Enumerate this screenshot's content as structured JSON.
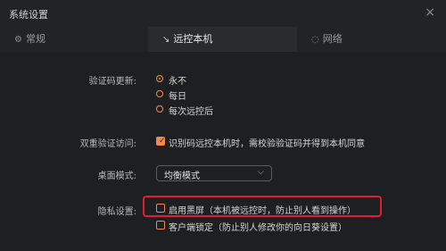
{
  "window": {
    "title": "系统设置",
    "close_label": "×"
  },
  "tabs": [
    {
      "label": "常规",
      "icon": "gear-icon",
      "glyph": "⚙"
    },
    {
      "label": "远控本机",
      "icon": "remote-control-icon",
      "glyph": "↘"
    },
    {
      "label": "网络",
      "icon": "network-icon",
      "glyph": "◌"
    }
  ],
  "verification": {
    "label": "验证码更新:",
    "options": [
      "永不",
      "每日",
      "每次远控后"
    ],
    "selected": "永不"
  },
  "two_factor": {
    "label": "双重验证访问:",
    "checkbox_label": "识别码远控本机时，需校验验证码并得到本机同意",
    "checked": true
  },
  "desktop_mode": {
    "label": "桌面模式:",
    "selected": "均衡模式",
    "chevron": "⌵"
  },
  "privacy": {
    "label": "隐私设置:",
    "options": [
      {
        "label": "启用黑屏（本机被远控时，防止别人看到操作）",
        "checked": false
      },
      {
        "label": "客户端锁定（防止别人修改你的向日葵设置）",
        "checked": false
      }
    ]
  },
  "accent_color": "#f08a4b",
  "highlight_color": "#e01f2b"
}
